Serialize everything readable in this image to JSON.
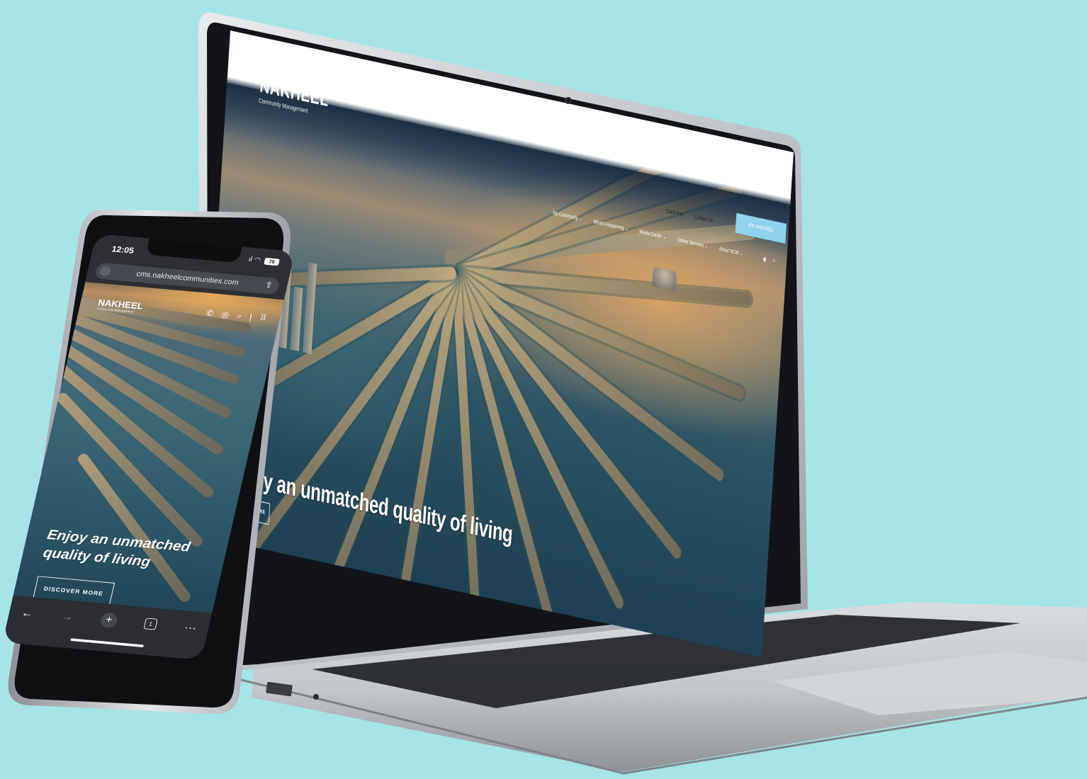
{
  "colors": {
    "background": "#a7e4e6",
    "cta": "#8fd3ea",
    "phone_chrome": "#2d2f33"
  },
  "laptop_site": {
    "logo_brand": "NAKHEEL",
    "logo_tagline": "Community Management",
    "top_links": [
      "Quick Pay",
      "Contact Us"
    ],
    "top_cta": "800 NAKHEEL",
    "nav": [
      "My Community ⌄",
      "What's Happening ⌄",
      "Media Center ⌄",
      "Online Services ⌄",
      "About NCM ⌄"
    ],
    "hero_headline": "Enjoy an unmatched quality of living",
    "hero_button": "DISCOVER MORE"
  },
  "phone": {
    "status_time": "12:05",
    "battery": "76",
    "url": "cms.nakheelcommunities.com",
    "logo_brand": "NAKHEEL",
    "logo_tagline": "Community Management",
    "hero_headline": "Enjoy an unmatched quality of living",
    "hero_button": "DISCOVER MORE",
    "tab_count": "1",
    "toolbar_icons": [
      "back-arrow-icon",
      "forward-arrow-icon",
      "new-tab-plus-icon",
      "tabs-icon",
      "more-icon"
    ]
  }
}
